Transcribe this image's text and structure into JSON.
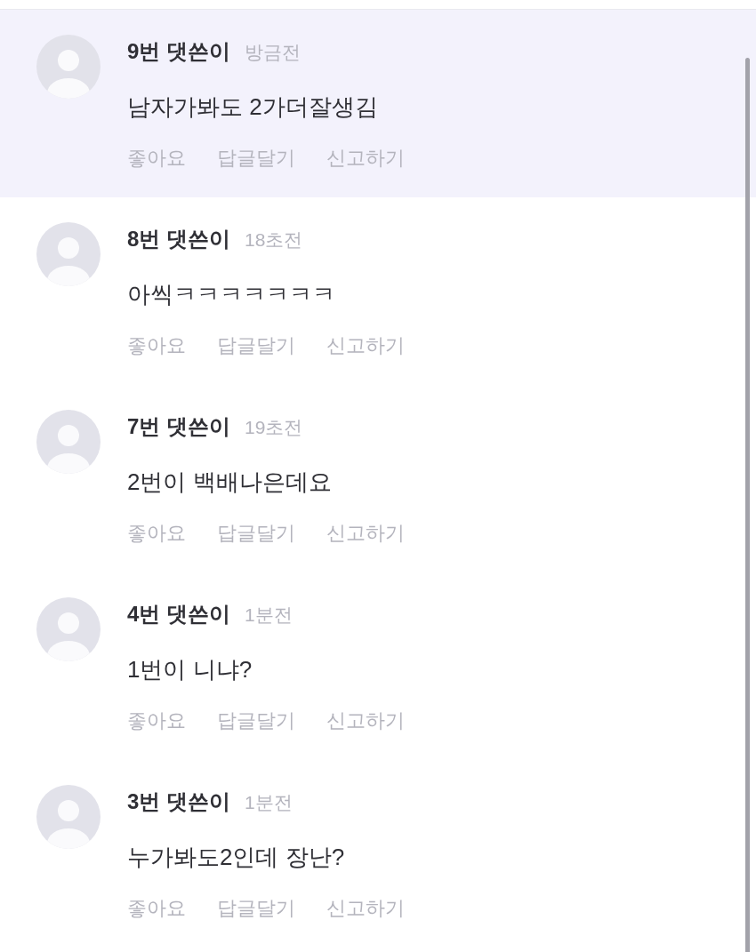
{
  "comments": [
    {
      "author": "9번 댓쓴이",
      "time": "방금전",
      "text": "남자가봐도 2가더잘생김",
      "highlighted": true,
      "actions": [
        "좋아요",
        "답글달기",
        "신고하기"
      ]
    },
    {
      "author": "8번 댓쓴이",
      "time": "18초전",
      "text": "아씩ㅋㅋㅋㅋㅋㅋㅋ",
      "highlighted": false,
      "actions": [
        "좋아요",
        "답글달기",
        "신고하기"
      ]
    },
    {
      "author": "7번 댓쓴이",
      "time": "19초전",
      "text": "2번이 백배나은데요",
      "highlighted": false,
      "actions": [
        "좋아요",
        "답글달기",
        "신고하기"
      ]
    },
    {
      "author": "4번 댓쓴이",
      "time": "1분전",
      "text": "1번이 니냐?",
      "highlighted": false,
      "actions": [
        "좋아요",
        "답글달기",
        "신고하기"
      ]
    },
    {
      "author": "3번 댓쓴이",
      "time": "1분전",
      "text": "누가봐도2인데 장난?",
      "highlighted": false,
      "actions": [
        "좋아요",
        "답글달기",
        "신고하기"
      ]
    }
  ]
}
